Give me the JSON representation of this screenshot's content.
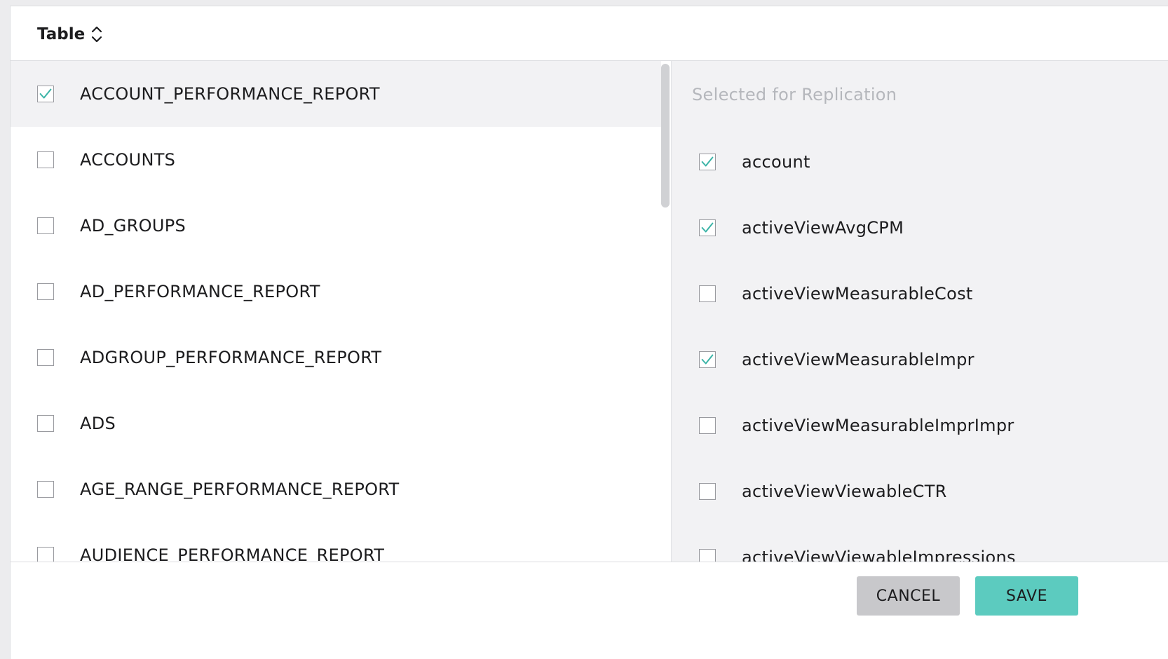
{
  "header": {
    "title": "Table",
    "sort_icon": "sort-updown-icon"
  },
  "colors": {
    "accent": "#5ccbbf",
    "checkmark": "#3bb4a7",
    "row_highlight": "#f2f2f4",
    "cancel_bg": "#c8c8cb"
  },
  "tables": [
    {
      "name": "ACCOUNT_PERFORMANCE_REPORT",
      "checked": true,
      "highlighted": true
    },
    {
      "name": "ACCOUNTS",
      "checked": false
    },
    {
      "name": "AD_GROUPS",
      "checked": false
    },
    {
      "name": "AD_PERFORMANCE_REPORT",
      "checked": false
    },
    {
      "name": "ADGROUP_PERFORMANCE_REPORT",
      "checked": false
    },
    {
      "name": "ADS",
      "checked": false
    },
    {
      "name": "AGE_RANGE_PERFORMANCE_REPORT",
      "checked": false
    },
    {
      "name": "AUDIENCE_PERFORMANCE_REPORT",
      "checked": false
    }
  ],
  "fields_panel": {
    "heading": "Selected for Replication",
    "fields": [
      {
        "name": "account",
        "checked": true
      },
      {
        "name": "activeViewAvgCPM",
        "checked": true
      },
      {
        "name": "activeViewMeasurableCost",
        "checked": false
      },
      {
        "name": "activeViewMeasurableImpr",
        "checked": true
      },
      {
        "name": "activeViewMeasurableImprImpr",
        "checked": false
      },
      {
        "name": "activeViewViewableCTR",
        "checked": false
      },
      {
        "name": "activeViewViewableImpressions",
        "checked": false
      }
    ]
  },
  "footer": {
    "cancel_label": "CANCEL",
    "save_label": "SAVE"
  }
}
